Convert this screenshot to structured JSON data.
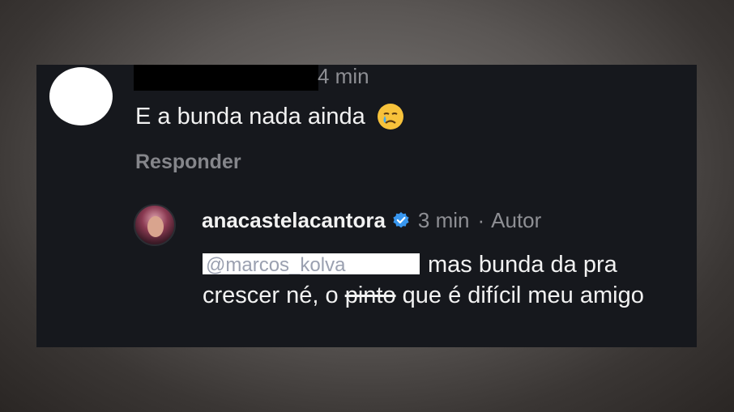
{
  "comment": {
    "time": "4 min",
    "text": "E a bunda nada ainda",
    "reply_label": "Responder"
  },
  "reply_comment": {
    "username": "anacastelacantora",
    "time": "3 min",
    "separator": "·",
    "author_label": "Autor",
    "mention": "@marcos_kolva",
    "text_part1": "mas bunda da pra crescer né, o ",
    "struck_word": "pinto",
    "text_part2": " que é difícil meu amigo"
  },
  "colors": {
    "background": "#16181d",
    "verified_badge": "#3897f0"
  }
}
